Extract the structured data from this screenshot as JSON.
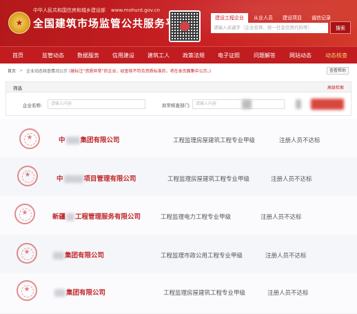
{
  "header": {
    "ministry": "中华人民共和国住房和城乡建设部",
    "url": "www.mohurd.gov.cn",
    "title": "全国建筑市场监管公共服务平台",
    "search_tabs": [
      "建设工程企业",
      "从业人员",
      "建设项目",
      "诚信记录"
    ],
    "search_placeholder": "请输入关键字（企业名称、统一社会信用代码等）",
    "search_button": "搜索"
  },
  "nav": {
    "items": [
      "首页",
      "监管动态",
      "数据服务",
      "信用建设",
      "建筑工人",
      "政策法规",
      "电子证照",
      "问题解答",
      "网站动态",
      "动态核查"
    ],
    "active_index": 9
  },
  "breadcrumb": {
    "home": "首页",
    "current": "企业动态核查情况公示",
    "note": "(被标注“资质异常”的企业，经查核不符合资质标准的，将在本页面集中公示。)",
    "button": "查看帮助"
  },
  "filter": {
    "title": "筛选",
    "advanced": "高级检索",
    "company_label": "企业名称:",
    "company_placeholder": "请输入内容",
    "dept_label": "异常核查部门:",
    "dept_placeholder": "请输入内容"
  },
  "results": [
    {
      "name_prefix": "中",
      "name_suffix": "集团有限公司",
      "qualification": "工程监理房屋建筑工程专业甲级",
      "status": "注册人员不达标"
    },
    {
      "name_prefix": "中",
      "name_suffix": "项目管理有限公司",
      "qualification": "工程监理房屋建筑工程专业甲级",
      "status": "注册人员不达标"
    },
    {
      "name_prefix": "新疆",
      "name_suffix": "工程管理服务有限公司",
      "qualification": "工程监理电力工程专业甲级",
      "status": "注册人员不达标"
    },
    {
      "name_prefix": "",
      "name_suffix": "集团有限公司",
      "qualification": "工程监理市政公用工程专业甲级",
      "status": "注册人员不达标"
    },
    {
      "name_prefix": "",
      "name_suffix": "集团有限公司",
      "qualification": "工程监理房屋建筑工程专业甲级",
      "status": "注册人员不达标"
    }
  ],
  "colors": {
    "brand_red": "#c91f22",
    "nav_active": "#ffd36b"
  }
}
